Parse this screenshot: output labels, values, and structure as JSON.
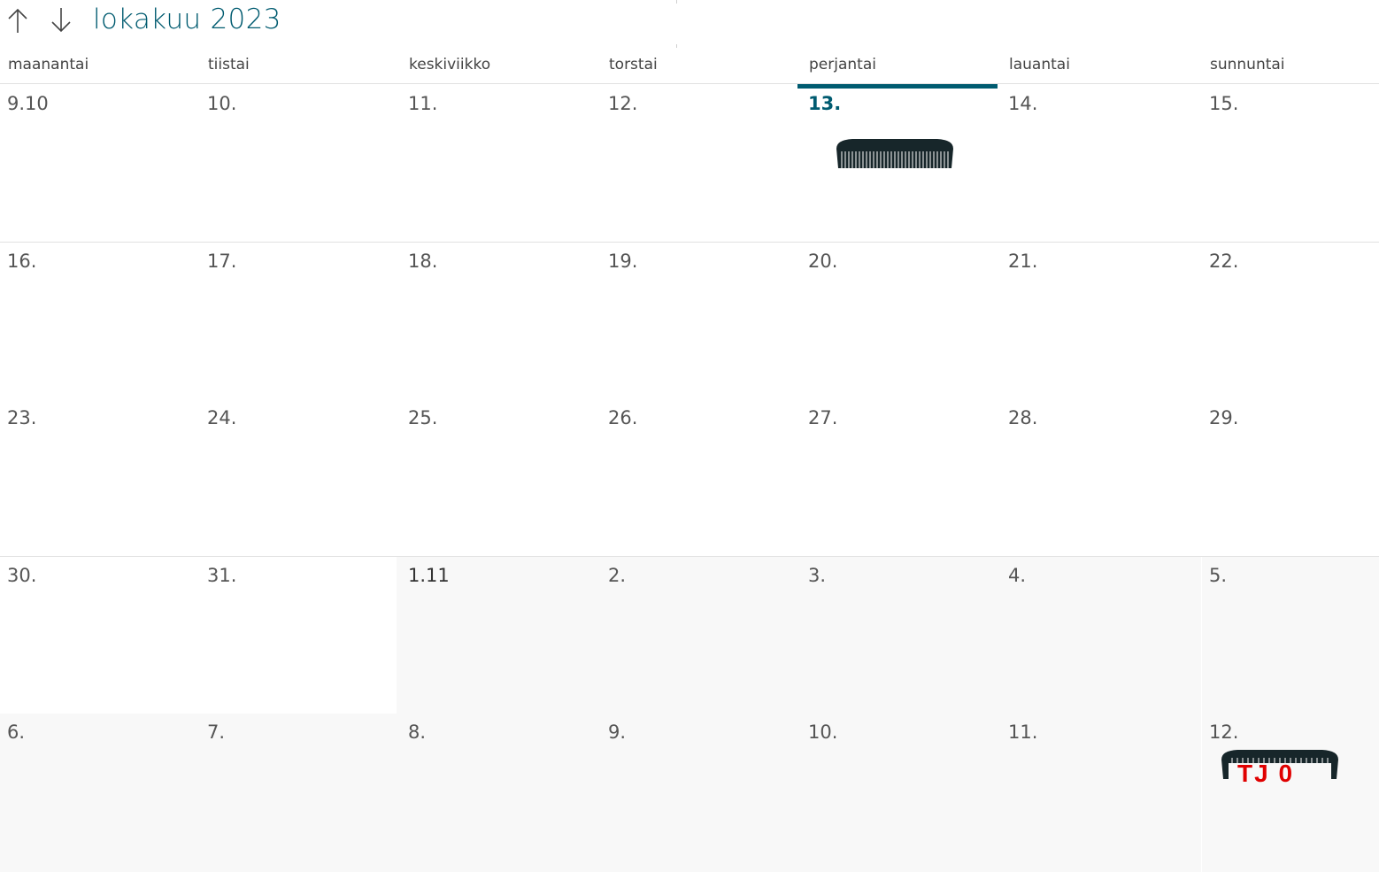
{
  "header": {
    "title": "lokakuu 2023",
    "prev_icon": "arrow-up-icon",
    "next_icon": "arrow-down-icon"
  },
  "weekdays": [
    "maanantai",
    "tiistai",
    "keskiviikko",
    "torstai",
    "perjantai",
    "lauantai",
    "sunnuntai"
  ],
  "today_column": 4,
  "weeks": [
    {
      "days": [
        "9.10",
        "10.",
        "11.",
        "12.",
        "13.",
        "14.",
        "15."
      ]
    },
    {
      "days": [
        "16.",
        "17.",
        "18.",
        "19.",
        "20.",
        "21.",
        "22."
      ]
    },
    {
      "days": [
        "23.",
        "24.",
        "25.",
        "26.",
        "27.",
        "28.",
        "29."
      ]
    },
    {
      "days": [
        "30.",
        "31.",
        "1.11",
        "2.",
        "3.",
        "4.",
        "5."
      ]
    },
    {
      "days": [
        "6.",
        "7.",
        "8.",
        "9.",
        "10.",
        "11.",
        "12."
      ]
    }
  ],
  "events": {
    "comb_sticker": "comb-icon",
    "tj_sticker_text": "TJ 0"
  },
  "colors": {
    "accent": "#005b70",
    "other_month_bg": "#f8f8f8",
    "sticker_text": "#e00000"
  }
}
